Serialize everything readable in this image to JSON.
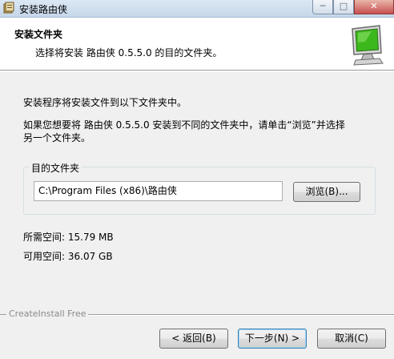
{
  "window": {
    "title": "安装路由侠",
    "controls": {
      "minimize": "─",
      "maximize": "□",
      "close": "✕"
    }
  },
  "header": {
    "title": "安装文件夹",
    "subtitle": "选择将安装 路由侠 0.5.5.0 的目的文件夹。",
    "icon": "monitor-icon"
  },
  "body": {
    "line1": "安装程序将安装文件到以下文件夹中。",
    "line2": "如果您想要将 路由侠 0.5.5.0 安装到不同的文件夹中，请单击“浏览”并选择",
    "line3": "另一个文件夹。"
  },
  "destination": {
    "legend": "目的文件夹",
    "path": "C:\\Program Files (x86)\\路由侠",
    "browse_label": "浏览(B)..."
  },
  "space": {
    "required": "所需空间: 15.79 MB",
    "available": "可用空间: 36.07 GB"
  },
  "footer": {
    "brand": "CreateInstall Free",
    "back_label": "< 返回(B)",
    "next_label": "下一步(N) >",
    "cancel_label": "取消(C)"
  },
  "colors": {
    "monitor_screen": "#3cb81c",
    "header_bg": "#ffffff",
    "window_bg": "#f0f0f0"
  }
}
